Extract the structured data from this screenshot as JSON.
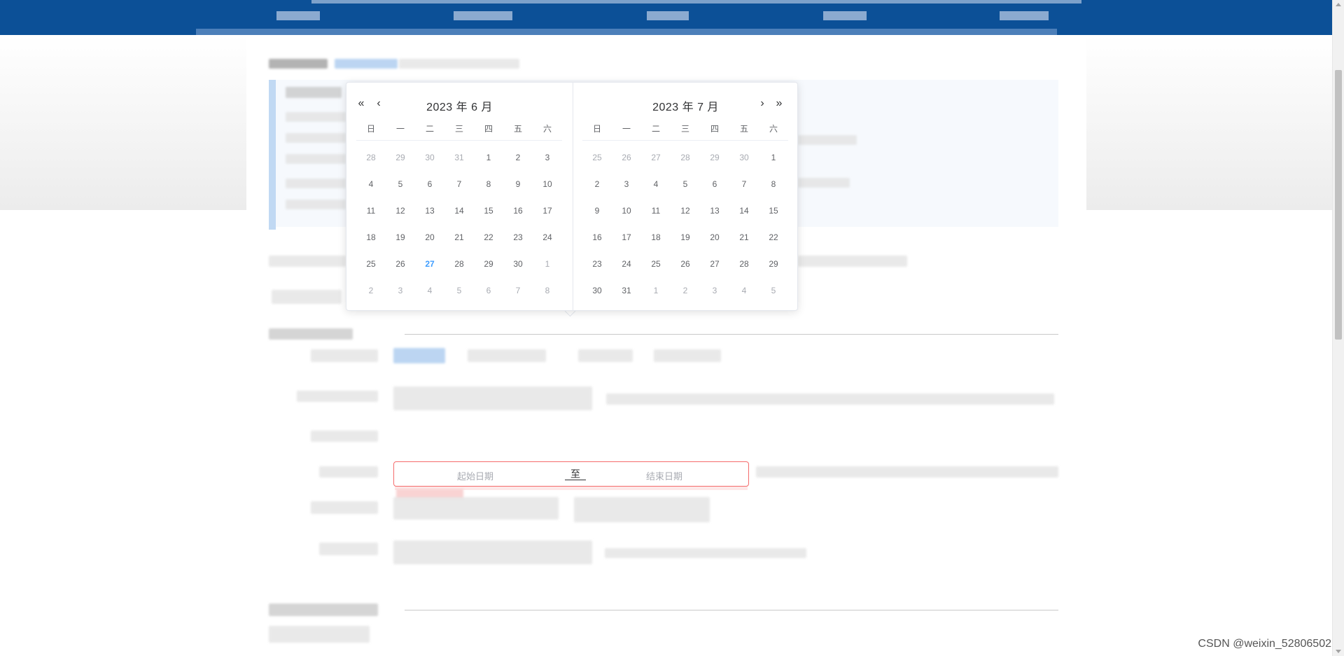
{
  "watermark": "CSDN @weixin_52806502",
  "date_range": {
    "start_placeholder": "起始日期",
    "separator": "至",
    "end_placeholder": "结束日期"
  },
  "colors": {
    "topbar": "#0c5097",
    "today": "#409eff",
    "error_border": "#f56c6c"
  },
  "picker": {
    "icons": {
      "prev_year": "double-chevron-left-icon",
      "prev_month": "chevron-left-icon",
      "next_month": "chevron-right-icon",
      "next_year": "double-chevron-right-icon"
    },
    "weekdays": [
      "日",
      "一",
      "二",
      "三",
      "四",
      "五",
      "六"
    ],
    "left": {
      "title": "2023 年 6 月",
      "weeks": [
        [
          {
            "d": "28",
            "o": true
          },
          {
            "d": "29",
            "o": true
          },
          {
            "d": "30",
            "o": true
          },
          {
            "d": "31",
            "o": true
          },
          {
            "d": "1"
          },
          {
            "d": "2"
          },
          {
            "d": "3"
          }
        ],
        [
          {
            "d": "4"
          },
          {
            "d": "5"
          },
          {
            "d": "6"
          },
          {
            "d": "7"
          },
          {
            "d": "8"
          },
          {
            "d": "9"
          },
          {
            "d": "10"
          }
        ],
        [
          {
            "d": "11"
          },
          {
            "d": "12"
          },
          {
            "d": "13"
          },
          {
            "d": "14"
          },
          {
            "d": "15"
          },
          {
            "d": "16"
          },
          {
            "d": "17"
          }
        ],
        [
          {
            "d": "18"
          },
          {
            "d": "19"
          },
          {
            "d": "20"
          },
          {
            "d": "21"
          },
          {
            "d": "22"
          },
          {
            "d": "23"
          },
          {
            "d": "24"
          }
        ],
        [
          {
            "d": "25"
          },
          {
            "d": "26"
          },
          {
            "d": "27",
            "today": true
          },
          {
            "d": "28"
          },
          {
            "d": "29"
          },
          {
            "d": "30"
          },
          {
            "d": "1",
            "o": true
          }
        ],
        [
          {
            "d": "2",
            "o": true
          },
          {
            "d": "3",
            "o": true
          },
          {
            "d": "4",
            "o": true
          },
          {
            "d": "5",
            "o": true
          },
          {
            "d": "6",
            "o": true
          },
          {
            "d": "7",
            "o": true
          },
          {
            "d": "8",
            "o": true
          }
        ]
      ]
    },
    "right": {
      "title": "2023 年 7 月",
      "weeks": [
        [
          {
            "d": "25",
            "o": true
          },
          {
            "d": "26",
            "o": true
          },
          {
            "d": "27",
            "o": true
          },
          {
            "d": "28",
            "o": true
          },
          {
            "d": "29",
            "o": true
          },
          {
            "d": "30",
            "o": true
          },
          {
            "d": "1"
          }
        ],
        [
          {
            "d": "2"
          },
          {
            "d": "3"
          },
          {
            "d": "4"
          },
          {
            "d": "5"
          },
          {
            "d": "6"
          },
          {
            "d": "7"
          },
          {
            "d": "8"
          }
        ],
        [
          {
            "d": "9"
          },
          {
            "d": "10"
          },
          {
            "d": "11"
          },
          {
            "d": "12"
          },
          {
            "d": "13"
          },
          {
            "d": "14"
          },
          {
            "d": "15"
          }
        ],
        [
          {
            "d": "16"
          },
          {
            "d": "17"
          },
          {
            "d": "18"
          },
          {
            "d": "19"
          },
          {
            "d": "20"
          },
          {
            "d": "21"
          },
          {
            "d": "22"
          }
        ],
        [
          {
            "d": "23"
          },
          {
            "d": "24"
          },
          {
            "d": "25"
          },
          {
            "d": "26"
          },
          {
            "d": "27"
          },
          {
            "d": "28"
          },
          {
            "d": "29"
          }
        ],
        [
          {
            "d": "30"
          },
          {
            "d": "31"
          },
          {
            "d": "1",
            "o": true
          },
          {
            "d": "2",
            "o": true
          },
          {
            "d": "3",
            "o": true
          },
          {
            "d": "4",
            "o": true
          },
          {
            "d": "5",
            "o": true
          }
        ]
      ]
    }
  }
}
